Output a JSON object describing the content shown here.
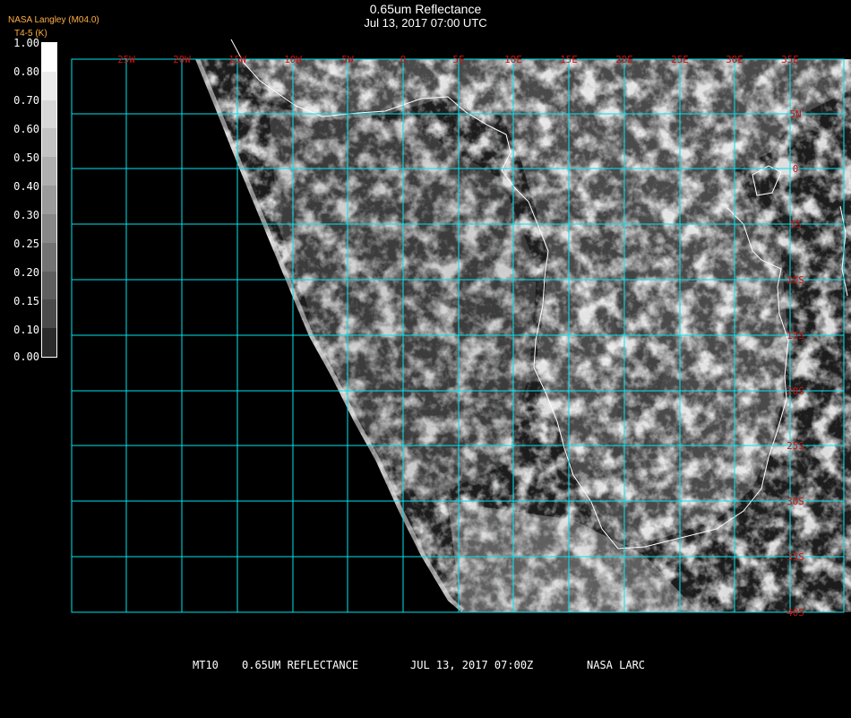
{
  "header": {
    "title": "0.65um Reflectance",
    "subtitle": "Jul 13, 2017 07:00 UTC",
    "credit_line1": "NASA Langley (M04.0)",
    "credit_line2": "T4-5 (K)"
  },
  "colorbar": {
    "ticks": [
      "1.00",
      "0.80",
      "0.70",
      "0.60",
      "0.50",
      "0.40",
      "0.30",
      "0.25",
      "0.20",
      "0.15",
      "0.10",
      "0.00"
    ],
    "colors": [
      "#ffffff",
      "#ebebeb",
      "#d7d7d7",
      "#c3c3c3",
      "#afafaf",
      "#9b9b9b",
      "#878787",
      "#737373",
      "#5f5f5f",
      "#4b4b4b",
      "#2b2b2b"
    ]
  },
  "grid": {
    "color": "#00e5ee",
    "label_color": "#d01010",
    "lon_labels": [
      "25W",
      "20W",
      "15W",
      "10W",
      "5W",
      "0",
      "5E",
      "10E",
      "15E",
      "20E",
      "25E",
      "30E",
      "35E"
    ],
    "lat_labels": [
      "5N",
      "0",
      "5S",
      "10S",
      "15S",
      "20S",
      "25S",
      "30S",
      "35S",
      "40S"
    ]
  },
  "footer": {
    "product": "MT10",
    "channel": "0.65UM REFLECTANCE",
    "datetime": "JUL 13, 2017 07:00Z",
    "source": "NASA LARC"
  }
}
